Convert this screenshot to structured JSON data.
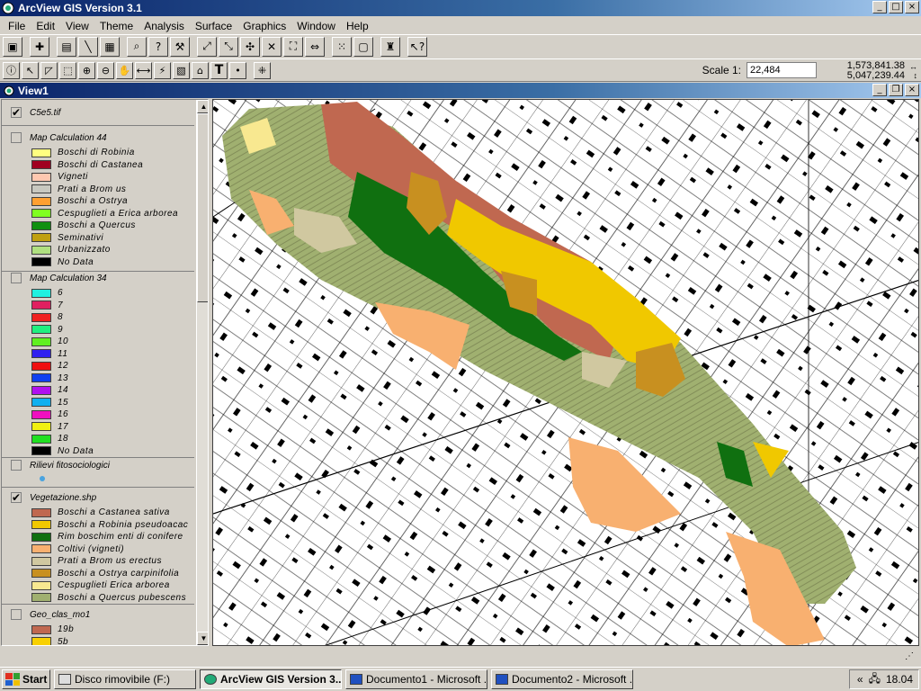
{
  "app": {
    "title": "ArcView GIS Version 3.1"
  },
  "menu": [
    "File",
    "Edit",
    "View",
    "Theme",
    "Analysis",
    "Surface",
    "Graphics",
    "Window",
    "Help"
  ],
  "toolbar": {
    "scale_label": "Scale 1:",
    "scale_value": "22,484",
    "coord_x": "1,573,841.38",
    "coord_y": "5,047,239.44"
  },
  "view": {
    "title": "View1"
  },
  "toc": {
    "themes": [
      {
        "name": "C5e5.tif",
        "checked": true,
        "items": []
      },
      {
        "name": "Map Calculation 44",
        "checked": false,
        "items": [
          {
            "label": "Boschi di Robinia",
            "color": "#ffff80"
          },
          {
            "label": "Boschi di Castanea",
            "color": "#a00020"
          },
          {
            "label": "Vigneti",
            "color": "#ffc8b0"
          },
          {
            "label": "Prati a Brom us",
            "color": "#c8c8c0"
          },
          {
            "label": "Boschi a Ostrya",
            "color": "#ffa030"
          },
          {
            "label": "Cespuglieti a Erica arborea",
            "color": "#80ff20"
          },
          {
            "label": "Boschi a Quercus",
            "color": "#109010"
          },
          {
            "label": "Seminativi",
            "color": "#c0a010"
          },
          {
            "label": "Urbanizzato",
            "color": "#b0e080"
          },
          {
            "label": "No Data",
            "color": "#000000"
          }
        ]
      },
      {
        "name": "Map Calculation 34",
        "checked": false,
        "items": [
          {
            "label": "6",
            "color": "#20f0e0"
          },
          {
            "label": "7",
            "color": "#e02060"
          },
          {
            "label": "8",
            "color": "#f02020"
          },
          {
            "label": "9",
            "color": "#20f080"
          },
          {
            "label": "10",
            "color": "#60f020"
          },
          {
            "label": "11",
            "color": "#3020f0"
          },
          {
            "label": "12",
            "color": "#f01010"
          },
          {
            "label": "13",
            "color": "#1040f0"
          },
          {
            "label": "14",
            "color": "#b010f0"
          },
          {
            "label": "15",
            "color": "#10b0f0"
          },
          {
            "label": "16",
            "color": "#f010c0"
          },
          {
            "label": "17",
            "color": "#f0f010"
          },
          {
            "label": "18",
            "color": "#20e020"
          },
          {
            "label": "No Data",
            "color": "#000000"
          }
        ]
      },
      {
        "name": "Rilievi fitosociologici",
        "checked": false,
        "items": []
      },
      {
        "name": "Vegetazione.shp",
        "checked": true,
        "items": [
          {
            "label": "Boschi a Castanea sativa",
            "color": "#c06850"
          },
          {
            "label": "Boschi a Robinia pseudoacac",
            "color": "#f0c800"
          },
          {
            "label": "Rim boschim enti di conifere",
            "color": "#107010"
          },
          {
            "label": "Coltivi (vigneti)",
            "color": "#f8b070"
          },
          {
            "label": "Prati a Brom us erectus",
            "color": "#d0c8a0"
          },
          {
            "label": "Boschi a Ostrya carpinifolia",
            "color": "#c89020"
          },
          {
            "label": "Cespuglieti Erica arborea",
            "color": "#f8e890"
          },
          {
            "label": "Boschi a Quercus pubescens",
            "color": "#a0b070"
          }
        ]
      },
      {
        "name": "Geo_clas_mo1",
        "checked": false,
        "items": [
          {
            "label": "19b",
            "color": "#c06850"
          },
          {
            "label": "5b",
            "color": "#f8d000"
          }
        ]
      }
    ]
  },
  "taskbar": {
    "start": "Start",
    "tasks": [
      "Disco rimovibile (F:)",
      "ArcView GIS Version 3...",
      "Documento1 - Microsoft ...",
      "Documento2 - Microsoft ..."
    ],
    "clock": "18.04"
  }
}
